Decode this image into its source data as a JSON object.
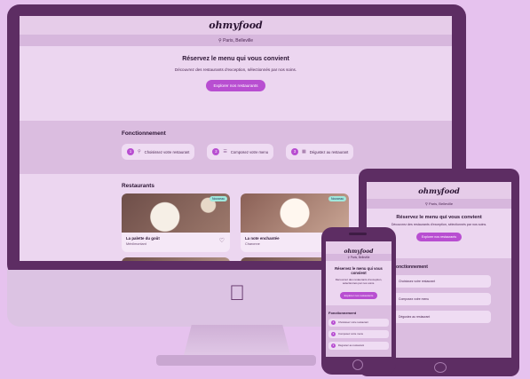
{
  "brand": "ohmyfood",
  "location": "Paris, Belleville",
  "hero": {
    "title": "Réservez le menu qui vous convient",
    "subtitle": "Découvrez des restaurants d'exception, sélectionnés par nos soins.",
    "cta": "Explorer nos restaurants"
  },
  "how": {
    "title": "Fonctionnement",
    "steps": [
      {
        "num": "1",
        "icon": "map-pin-icon",
        "label": "Choisissez votre restaurant"
      },
      {
        "num": "2",
        "icon": "list-icon",
        "label": "Composez votre menu"
      },
      {
        "num": "3",
        "icon": "calendar-icon",
        "label": "Dégustez au restaurant"
      }
    ]
  },
  "restaurants": {
    "title": "Restaurants",
    "items": [
      {
        "name": "La palette du goût",
        "area": "Ménilmontant",
        "badge": "Nouveau"
      },
      {
        "name": "La note enchantée",
        "area": "Charonne",
        "badge": "Nouveau"
      }
    ]
  },
  "colors": {
    "background": "#e6c2ee",
    "accent": "#b84ed1",
    "device": "#5d2d63"
  }
}
